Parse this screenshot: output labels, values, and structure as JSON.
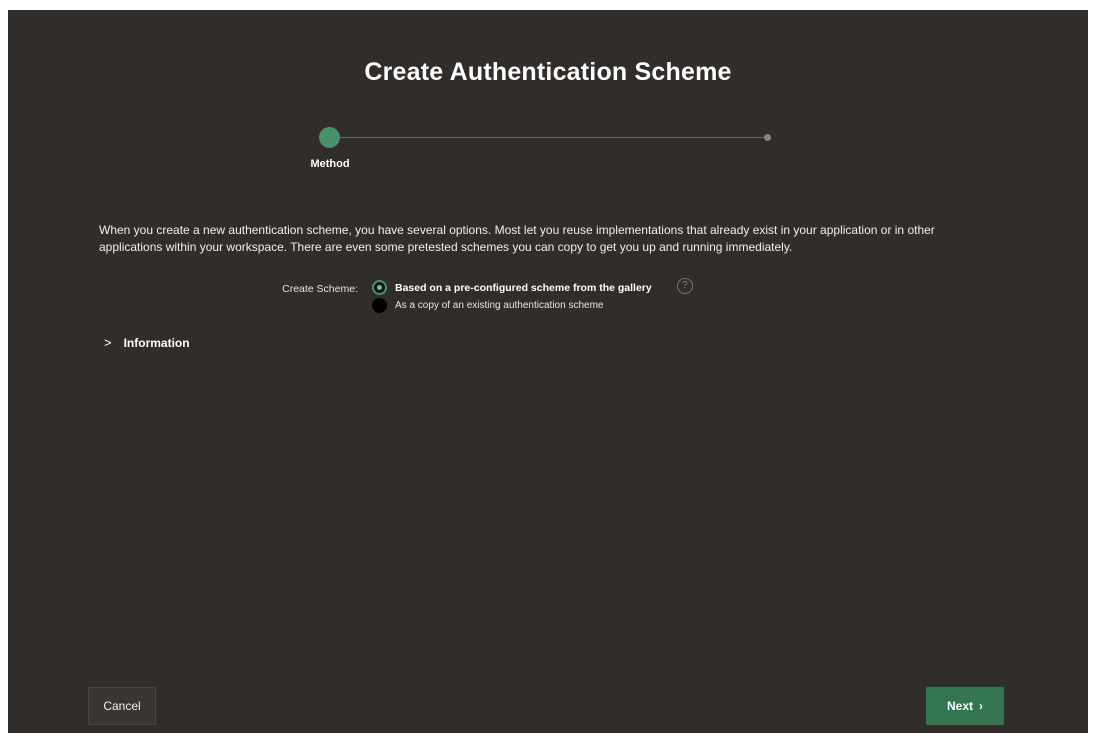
{
  "dialog": {
    "title": "Create Authentication Scheme"
  },
  "train": {
    "steps": [
      {
        "label": "Method",
        "state": "current"
      },
      {
        "label": "",
        "state": "pending"
      }
    ]
  },
  "intro": {
    "text": "When you create a new authentication scheme, you have several options. Most let you reuse implementations that already exist in your application or in other applications within your workspace. There are even some pretested schemes you can copy to get you up and running immediately."
  },
  "create_scheme": {
    "label": "Create Scheme:",
    "options": [
      {
        "label": "Based on a pre-configured scheme from the gallery",
        "selected": true
      },
      {
        "label": "As a copy of an existing authentication scheme",
        "selected": false
      }
    ],
    "help_glyph": "?"
  },
  "information": {
    "label": "Information",
    "expanded": false
  },
  "footer": {
    "cancel_label": "Cancel",
    "next_label": "Next",
    "next_glyph": "›"
  },
  "colors": {
    "background": "#312d2a",
    "accent": "#48916a",
    "primary_button": "#347652"
  }
}
